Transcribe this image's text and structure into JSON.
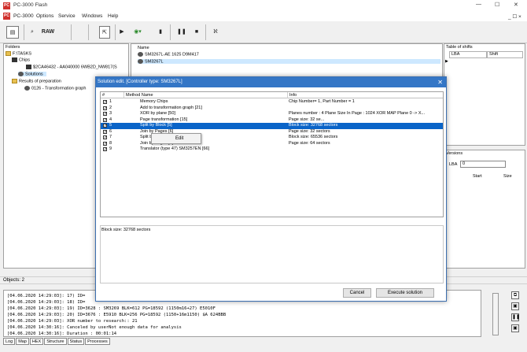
{
  "window": {
    "title": "PC-3000 Flash",
    "min": "—",
    "max": "☐",
    "close": "✕"
  },
  "menu": {
    "app": "PC-3000",
    "items": [
      "Options",
      "Service",
      "Windows",
      "Help"
    ],
    "ctrls": "_ ☐ ×"
  },
  "toolbar": {
    "raw": "RAW"
  },
  "folders": {
    "title": "Folders",
    "items": [
      "F:\\TASKS",
      "Chips",
      "$2CA46432 - AA040000 6WB2D_NW817(S",
      "Solutions",
      "Results of preparation",
      "0126 - Transformation graph"
    ]
  },
  "names": {
    "header": "Name",
    "rows": [
      "SM3267L-AE 1625 D9M417",
      "SM3267L"
    ]
  },
  "shifts": {
    "title": "Table of shifts",
    "col_lba": "LBA",
    "col_shift": "Shift"
  },
  "versions": {
    "title": "Versions",
    "lba_label": "LBA",
    "lba_value": "0",
    "col_start": "Start",
    "col_size": "Size"
  },
  "objects": {
    "label": "Objects: 2"
  },
  "dialog": {
    "title": "Solution edit. [Controller type: SM3267L]",
    "close": "✕",
    "columns": {
      "num": "#",
      "method": "Method Name",
      "info": "Info"
    },
    "rows": [
      {
        "n": "1",
        "method": "Memory Chips",
        "info": "Chip Number= 1, Part Number = 1"
      },
      {
        "n": "2",
        "method": "Add to transformation graph [21]",
        "info": ""
      },
      {
        "n": "3",
        "method": "XOR by plane [50]",
        "info": "Planes number : 4 Plane Size In Page : 1024 XOR MAP Plane 0 -> X..."
      },
      {
        "n": "4",
        "method": "Page transformation [15]",
        "info": "Page size: 32 se..."
      },
      {
        "n": "5",
        "method": "Split by Block [5]",
        "info": "Block size: 32768 sectors"
      },
      {
        "n": "6",
        "method": "Join by Pages [6]",
        "info": "Page size: 32 sectors"
      },
      {
        "n": "7",
        "method": "Split by Block [5]",
        "info": "Block size: 65536 sectors"
      },
      {
        "n": "8",
        "method": "Join by Pages [6]",
        "info": "Page size: 64 sectors"
      },
      {
        "n": "9",
        "method": "Translator (type 47) SM3257EN [66]",
        "info": ""
      }
    ],
    "context_menu": "Edit",
    "details": "Block size: 32768 sectors",
    "cancel": "Cancel",
    "execute": "Execute solution"
  },
  "log": [
    "[04.06.2020 14:29:03]: 17) ID=",
    "[04.06.2020 14:29:03]: 18) ID=",
    "[04.06.2020 14:29:03]: 19) ID=3628 : SM3269 BLK=612 PG=18592 (1150m16+27) E5010F",
    "[04.06.2020 14:29:03]: 20) ID=3676 : E5910 BLK=256 PG=18592 (1150+16m1150) $A 624BBB",
    "[04.06.2020 14:29:03]: XOR number to research:: 21",
    "[04.06.2020 14:30:16]: Canceled by userNot enough data for analysis",
    "[04.06.2020 14:30:16]: Duration : 00:01:14"
  ],
  "tabs": [
    "Log",
    "Map",
    "HEX",
    "Structure",
    "Status",
    "Processes"
  ]
}
